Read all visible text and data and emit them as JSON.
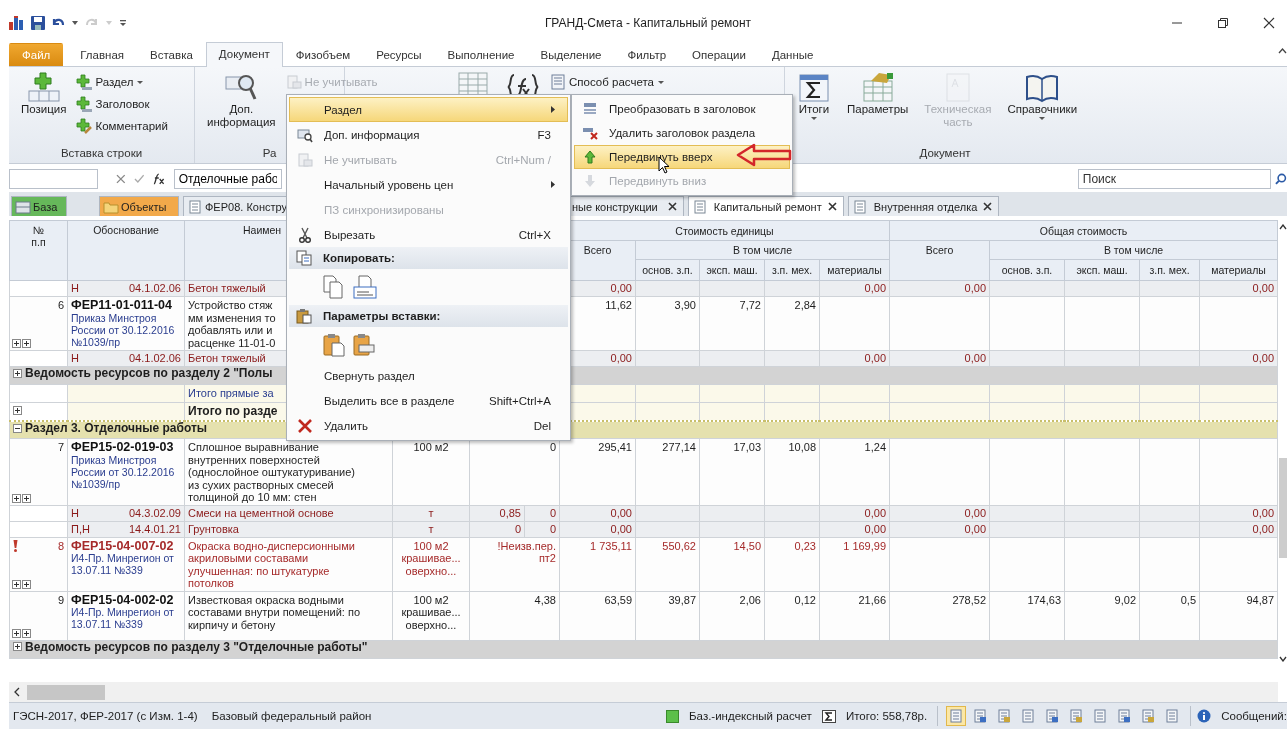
{
  "window": {
    "title": "ГРАНД-Смета - Капитальный ремонт"
  },
  "ribbon_tabs": [
    {
      "label": "Файл",
      "kind": "file",
      "selected": false
    },
    {
      "label": "Главная",
      "kind": "tab",
      "selected": false
    },
    {
      "label": "Вставка",
      "kind": "tab",
      "selected": false
    },
    {
      "label": "Документ",
      "kind": "tab",
      "selected": true
    },
    {
      "label": "Физобъем",
      "kind": "tab",
      "selected": false
    },
    {
      "label": "Ресурсы",
      "kind": "tab",
      "selected": false
    },
    {
      "label": "Выполнение",
      "kind": "tab",
      "selected": false
    },
    {
      "label": "Выделение",
      "kind": "tab",
      "selected": false
    },
    {
      "label": "Фильтр",
      "kind": "tab",
      "selected": false
    },
    {
      "label": "Операции",
      "kind": "tab",
      "selected": false
    },
    {
      "label": "Данные",
      "kind": "tab",
      "selected": false
    }
  ],
  "ribbon_groups": [
    {
      "label": "Вставка строки",
      "items": [
        {
          "kind": "large",
          "label": "Позиция",
          "disabled": false,
          "dropdown": false
        },
        {
          "kind": "small",
          "label": "Раздел",
          "disabled": false,
          "dropdown": true
        },
        {
          "kind": "small",
          "label": "Заголовок",
          "disabled": false,
          "dropdown": false
        },
        {
          "kind": "small",
          "label": "Комментарий",
          "disabled": false,
          "dropdown": false
        }
      ]
    },
    {
      "label": "Ра",
      "items": [
        {
          "kind": "large",
          "label": "Доп.\nинформация",
          "disabled": false,
          "dropdown": false
        },
        {
          "kind": "small",
          "label": "Не учитывать",
          "disabled": true,
          "dropdown": false
        }
      ]
    },
    {
      "items": [
        {
          "kind": "large",
          "disabled": false,
          "dropdown": false
        },
        {
          "kind": "large",
          "disabled": false,
          "dropdown": false
        },
        {
          "kind": "small",
          "label": "Способ расчета",
          "disabled": false,
          "dropdown": true
        }
      ]
    },
    {
      "label": "Документ",
      "items": [
        {
          "kind": "large",
          "label": "Итоги",
          "disabled": false,
          "dropdown": true
        },
        {
          "kind": "large",
          "label": "Параметры",
          "disabled": false,
          "dropdown": false
        },
        {
          "kind": "large",
          "label": "Техническая\nчасть",
          "disabled": true,
          "dropdown": false
        },
        {
          "kind": "large",
          "label": "Справочники",
          "disabled": false,
          "dropdown": true
        }
      ]
    }
  ],
  "formula_bar": {
    "value": "Отделочные рабо"
  },
  "search": {
    "placeholder": "Поиск"
  },
  "doc_tabs": [
    {
      "label": "База",
      "kind": "base",
      "selected": false
    },
    {
      "label": "Объекты",
      "kind": "objects",
      "selected": false
    },
    {
      "label": "ФЕР08. Констру",
      "kind": "doc",
      "selected": false
    },
    {
      "label": "ные конструкции",
      "kind": "doc",
      "selected": false
    },
    {
      "label": "Капитальный ремонт",
      "kind": "doc",
      "selected": true
    },
    {
      "label": "Внутренняя отделка",
      "kind": "doc",
      "selected": false
    }
  ],
  "table": {
    "header": {
      "num": "№\nп.п",
      "code": "Обоснование",
      "name": "Наимен",
      "unit_cost": "Стоимость единицы",
      "total_cost": "Общая стоимость",
      "u_total": "Всего",
      "u_incl": "В том числе",
      "t_total": "Всего",
      "t_incl": "В том числе",
      "sub": [
        "основ. з.п.",
        "эксп. маш.",
        "з.п. мех.",
        "материалы",
        "основ. з.п.",
        "эксп. маш.",
        "з.п. мех.",
        "материалы"
      ]
    },
    "rows": [
      {
        "kind": "resource",
        "type": "Н",
        "code": "04.1.02.06",
        "name": "Бетон тяжелый",
        "u_total": "0,00",
        "u_mat": "0,00",
        "t_total": "0,00",
        "t_mat": "0,00"
      },
      {
        "kind": "position",
        "flagged": false,
        "num": "6",
        "code": "ФЕР11-01-011-04",
        "basis": "Приказ Минстроя\nРоссии от 30.12.2016\n№1039/пр",
        "name": "Устройство стяж\nмм изменения то\nдобавлять или и\nрасценке 11-01-0",
        "u_total": "11,62",
        "u_wage": "3,90",
        "u_mach": "7,72",
        "u_mech": "2,84"
      },
      {
        "kind": "resource",
        "type": "Н",
        "code": "04.1.02.06",
        "name": "Бетон тяжелый",
        "u_total": "0,00",
        "u_mat": "0,00",
        "t_total": "0,00",
        "t_mat": "0,00"
      },
      {
        "kind": "group",
        "expanded": false,
        "label": "Ведомость ресурсов по разделу 2 \"Полы"
      },
      {
        "kind": "total",
        "bold": false,
        "label": "Итого прямые за"
      },
      {
        "kind": "total",
        "bold": true,
        "expanded": false,
        "label": "Итого по разде"
      },
      {
        "kind": "section",
        "expanded": true,
        "label": "Раздел 3. Отделочные работы"
      },
      {
        "kind": "position",
        "flagged": false,
        "num": "7",
        "code": "ФЕР15-02-019-03",
        "basis": "Приказ Минстроя\nРоссии от 30.12.2016\n№1039/пр",
        "name": "Сплошное выравнивание\nвнутренних поверхностей\n(однослойное оштукатуривание)\nиз сухих растворных смесей\nтолщиной до 10 мм: стен",
        "unit": "100 м2",
        "qty": "0",
        "u_total": "295,41",
        "u_wage": "277,14",
        "u_mach": "17,03",
        "u_mech": "10,08",
        "u_mat": "1,24"
      },
      {
        "kind": "resource",
        "type": "Н",
        "code": "04.3.02.09",
        "name": "Смеси на цементной основе",
        "unit": "т",
        "qty_a": "0,85",
        "qty_b": "0",
        "u_total": "0,00",
        "u_mat": "0,00",
        "t_total": "0,00",
        "t_mat": "0,00"
      },
      {
        "kind": "resource",
        "type": "П,Н",
        "code": "14.4.01.21",
        "name": "Грунтовка",
        "unit": "т",
        "qty_a": "0",
        "qty_b": "0",
        "u_total": "0,00",
        "u_mat": "0,00",
        "t_total": "0,00",
        "t_mat": "0,00"
      },
      {
        "kind": "position",
        "flagged": true,
        "num": "8",
        "code": "ФЕР15-04-007-02",
        "basis": "И4-Пр. Минрегион от\n13.07.11 №339",
        "name": "Окраска водно-дисперсионными\nакриловыми составами\nулучшенная: по штукатурке\nпотолков",
        "unit": "100 м2\nкрашивае...\nоверхно...",
        "qty": "!Неизв.пер.\nпт2",
        "u_total": "1 735,11",
        "u_wage": "550,62",
        "u_mach": "14,50",
        "u_mech": "0,23",
        "u_mat": "1 169,99"
      },
      {
        "kind": "position",
        "flagged": false,
        "num": "9",
        "code": "ФЕР15-04-002-02",
        "basis": "И4-Пр. Минрегион от\n13.07.11 №339",
        "name": "Известковая окраска водными\nсоставами внутри помещений: по\nкирпичу и бетону",
        "unit": "100 м2\nкрашивае...\nоверхно...",
        "qty": "4,38",
        "u_total": "63,59",
        "u_wage": "39,87",
        "u_mach": "2,06",
        "u_mech": "0,12",
        "u_mat": "21,66",
        "t_total": "278,52",
        "t_wage": "174,63",
        "t_mach": "9,02",
        "t_mech": "0,5",
        "t_mat": "94,87"
      },
      {
        "kind": "group",
        "expanded": false,
        "label": "Ведомость ресурсов по разделу 3 \"Отделочные работы\""
      }
    ]
  },
  "context_menu": [
    {
      "kind": "submenu",
      "label": "Раздел",
      "selected": true,
      "disabled": false
    },
    {
      "kind": "item",
      "label": "Доп. информация",
      "shortcut": "F3",
      "selected": false,
      "disabled": false
    },
    {
      "kind": "item",
      "label": "Не учитывать",
      "shortcut": "Ctrl+Num /",
      "selected": false,
      "disabled": true
    },
    {
      "kind": "submenu",
      "label": "Начальный уровень цен",
      "selected": false,
      "disabled": false
    },
    {
      "kind": "item",
      "label": "ПЗ синхронизированы",
      "selected": false,
      "disabled": true
    },
    {
      "kind": "item",
      "label": "Вырезать",
      "shortcut": "Ctrl+X",
      "selected": false,
      "disabled": false
    },
    {
      "kind": "header",
      "label": "Копировать:"
    },
    {
      "kind": "icons"
    },
    {
      "kind": "header",
      "label": "Параметры вставки:"
    },
    {
      "kind": "icons"
    },
    {
      "kind": "item",
      "label": "Свернуть раздел",
      "selected": false,
      "disabled": false
    },
    {
      "kind": "item",
      "label": "Выделить все в разделе",
      "shortcut": "Shift+Ctrl+A",
      "selected": false,
      "disabled": false
    },
    {
      "kind": "item",
      "label": "Удалить",
      "shortcut": "Del",
      "selected": false,
      "disabled": false
    }
  ],
  "submenu": [
    {
      "label": "Преобразовать в заголовок",
      "selected": false,
      "disabled": false
    },
    {
      "label": "Удалить заголовок раздела",
      "selected": false,
      "disabled": false
    },
    {
      "label": "Передвинуть вверх",
      "selected": true,
      "disabled": false
    },
    {
      "label": "Передвинуть вниз",
      "selected": false,
      "disabled": true
    }
  ],
  "status_bar": {
    "norms": "ГЭСН-2017, ФЕР-2017 (с Изм. 1-4)",
    "region": "Базовый федеральный район",
    "mode": "Баз.-индексный расчет",
    "total": "Итого: 558,78р.",
    "view_buttons": [
      {
        "selected": true
      },
      {
        "selected": false
      },
      {
        "selected": false
      },
      {
        "selected": false
      },
      {
        "selected": false
      },
      {
        "selected": false
      },
      {
        "selected": false
      },
      {
        "selected": false
      },
      {
        "selected": false
      },
      {
        "selected": false
      }
    ],
    "messages": "Сообщений:"
  }
}
